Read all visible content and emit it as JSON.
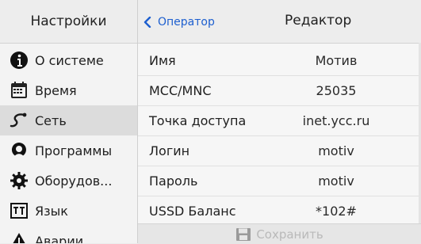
{
  "sidebar": {
    "title": "Настройки",
    "items": [
      {
        "label": "О системе",
        "icon": "info-icon"
      },
      {
        "label": "Время",
        "icon": "calendar-icon"
      },
      {
        "label": "Сеть",
        "icon": "network-icon",
        "active": true
      },
      {
        "label": "Программы",
        "icon": "programs-icon"
      },
      {
        "label": "Оборудов...",
        "icon": "gear-icon"
      },
      {
        "label": "Язык",
        "icon": "language-icon"
      },
      {
        "label": "Аварии",
        "icon": "warning-icon"
      }
    ]
  },
  "header": {
    "back_label": "Оператор",
    "title": "Редактор"
  },
  "fields": [
    {
      "label": "Имя",
      "value": "Мотив"
    },
    {
      "label": "MCC/MNC",
      "value": "25035"
    },
    {
      "label": "Точка доступа",
      "value": "inet.ycc.ru"
    },
    {
      "label": "Логин",
      "value": "motiv"
    },
    {
      "label": "Пароль",
      "value": "motiv"
    },
    {
      "label": "USSD Баланс",
      "value": "*102#"
    }
  ],
  "save_label": "Сохранить",
  "colors": {
    "accent": "#1d5fcf",
    "active_item": "#dcdcdc",
    "disabled": "#b9b9b9"
  }
}
